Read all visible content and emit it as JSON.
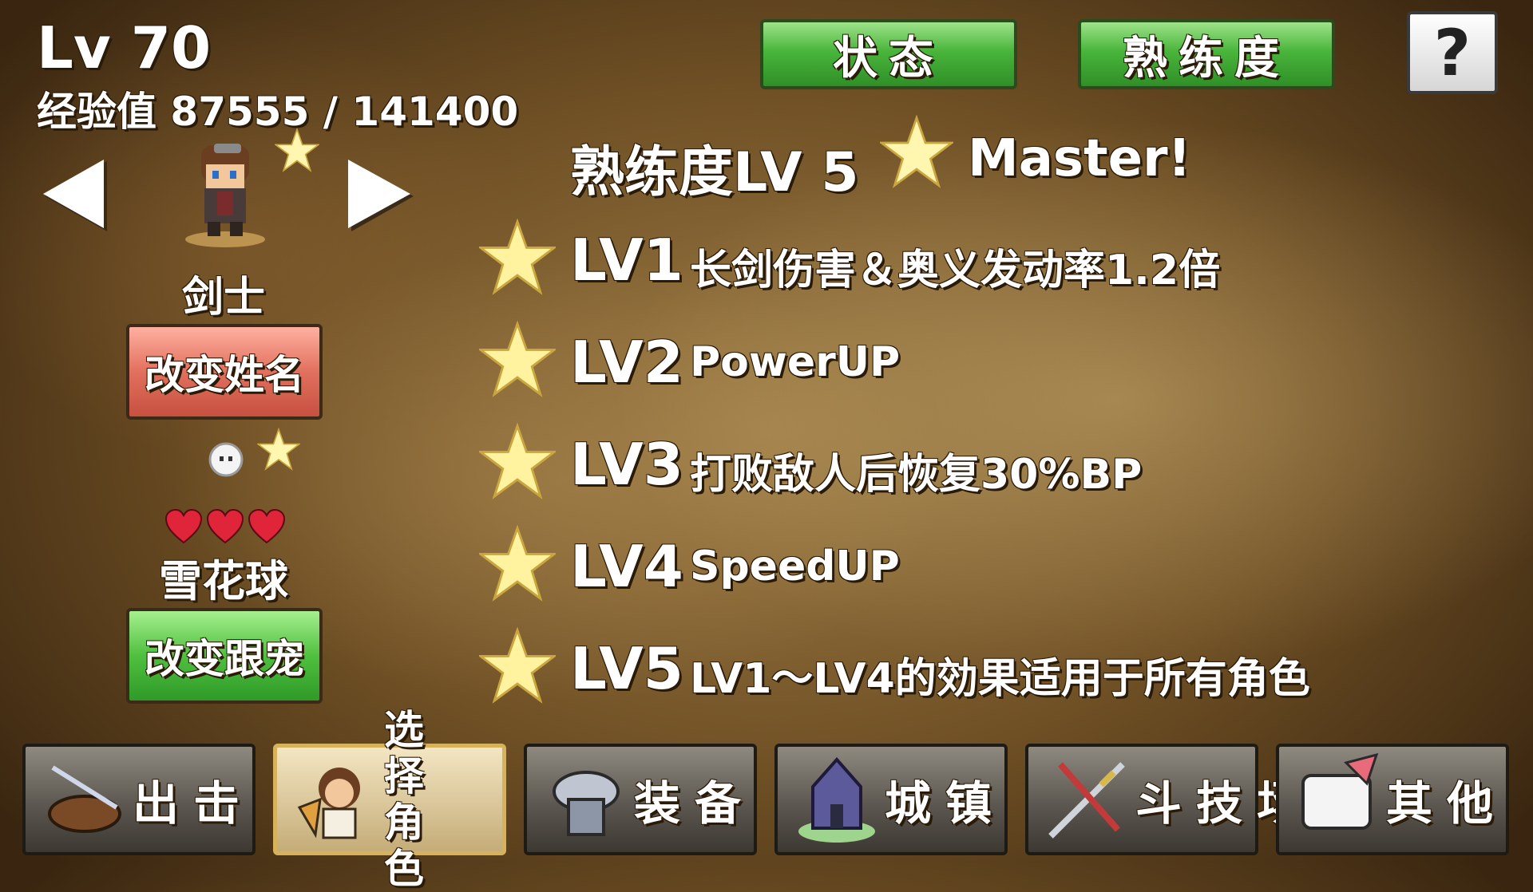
{
  "header": {
    "level": "Lv 70",
    "exp": "经验值 87555 / 141400"
  },
  "tabs": [
    {
      "label": "状态"
    },
    {
      "label": "熟练度"
    }
  ],
  "help_label": "?",
  "character": {
    "class": "剑士",
    "rename_label": "改变姓名"
  },
  "pet": {
    "hearts": 3,
    "name": "雪花球",
    "change_label": "改变跟宠"
  },
  "mastery": {
    "title": "熟练度LV  5",
    "badge": "Master!",
    "levels": [
      {
        "lv": "LV1",
        "desc": "长剑伤害＆奥义发动率1.2倍"
      },
      {
        "lv": "LV2",
        "desc": "PowerUP"
      },
      {
        "lv": "LV3",
        "desc": "打败敌人后恢复30%BP"
      },
      {
        "lv": "LV4",
        "desc": "SpeedUP"
      },
      {
        "lv": "LV5",
        "desc": "LV1～LV4的効果适用于所有角色"
      }
    ]
  },
  "nav": [
    {
      "label": "出击",
      "icon": "ship-icon"
    },
    {
      "label": "选择角色",
      "line1": "选择",
      "line2": "角色",
      "icon": "character-select-icon",
      "active": true
    },
    {
      "label": "装备",
      "icon": "armor-icon"
    },
    {
      "label": "城镇",
      "icon": "town-icon"
    },
    {
      "label": "斗技场",
      "icon": "swords-icon"
    },
    {
      "label": "其他",
      "icon": "scroll-icon"
    }
  ],
  "colors": {
    "tab_green": "#49b53b",
    "rename_red": "#e2705e",
    "pet_green": "#4fc03f",
    "star_yellow": "#fff3a0",
    "heart_red": "#e0243a"
  }
}
